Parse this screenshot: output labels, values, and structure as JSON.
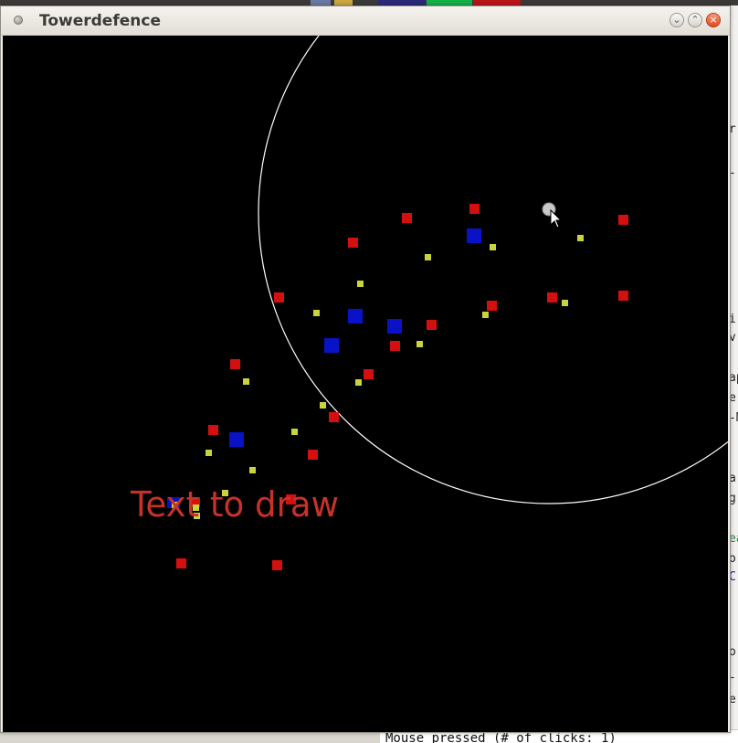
{
  "window": {
    "title": "Towerdefence",
    "controls": {
      "minimize_symbol": "⌄",
      "maximize_symbol": "⌃",
      "close_symbol": "×"
    }
  },
  "game": {
    "background_color": "#000000",
    "draw_text": "Text to draw",
    "draw_text_color": "#c8312a",
    "range_circle_color": "#ffffff",
    "colors": {
      "enemy": "#d40f0f",
      "tower": "#0a12c8",
      "projectile": "#c9d43c"
    },
    "enemy_count": 22,
    "tower_count": 5,
    "projectile_count": 18
  },
  "background": {
    "console_text": "Mouse pressed (# of clicks: 1)",
    "side_fragments": [
      "r",
      "-",
      "i:",
      "v",
      "ap",
      "er",
      "-M",
      "ar",
      "g",
      "ea",
      "o",
      "C",
      "or",
      "-",
      "e"
    ]
  }
}
